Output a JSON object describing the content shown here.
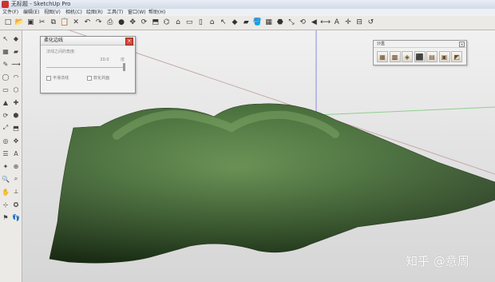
{
  "window": {
    "title": "无标题 - SketchUp Pro"
  },
  "menu": [
    "文件(F)",
    "编辑(E)",
    "视图(V)",
    "相机(C)",
    "绘图(R)",
    "工具(T)",
    "窗口(W)",
    "帮助(H)"
  ],
  "toolbar": {
    "icons": [
      "new-file-icon",
      "open-folder-icon",
      "save-icon",
      "cut-icon",
      "copy-icon",
      "paste-icon",
      "erase-icon",
      "undo-icon",
      "redo-icon",
      "print-icon",
      "model-info-icon",
      "move-icon",
      "rotate-icon",
      "push-pull-icon",
      "offset-icon",
      "iso-view-icon",
      "top-view-icon",
      "front-view-icon",
      "house-icon",
      "select-arrow-icon",
      "material-icon",
      "erase-tool-icon",
      "paint-bucket-icon",
      "components-icon",
      "follow-me-icon",
      "scale-icon",
      "rotate-tool-icon",
      "tape-icon",
      "dimension-icon",
      "text-icon",
      "axes-icon",
      "section-icon",
      "undo-view-icon"
    ],
    "glyphs": [
      "□",
      "📂",
      "▣",
      "✂",
      "⧉",
      "📋",
      "✕",
      "↶",
      "↷",
      "⎙",
      "●",
      "✥",
      "⟳",
      "⬒",
      "⌬",
      "⌂",
      "▭",
      "▯",
      "⌂",
      "↖",
      "◆",
      "▰",
      "🪣",
      "▦",
      "⬣",
      "⤡",
      "⟲",
      "◀",
      "⟷",
      "A",
      "✛",
      "⊟",
      "↺"
    ]
  },
  "lefttools": {
    "glyphs": [
      "↖",
      "◆",
      "▦",
      "▰",
      "✎",
      "⟿",
      "◯",
      "◠",
      "▭",
      "⬡",
      "▲",
      "✚",
      "⟳",
      "⬢",
      "⤢",
      "⬒",
      "◎",
      "✥",
      "☰",
      "A",
      "✦",
      "⊕",
      "🔍",
      "⌕",
      "✋",
      "⟂",
      "⊹",
      "✪",
      "⚑",
      "👣"
    ]
  },
  "soften_dialog": {
    "title": "柔化边线",
    "close": "×",
    "angle_label": "法线之间的角度:",
    "angle_value": "20.0",
    "unit": "度",
    "option_smooth": "平滑法线",
    "option_coplanar": "软化共面"
  },
  "sandbox": {
    "title": "沙盒",
    "close": "×",
    "tools": [
      "sandbox-from-contours-icon",
      "sandbox-from-scratch-icon",
      "smoove-icon",
      "stamp-icon",
      "drape-icon",
      "add-detail-icon",
      "flip-edge-icon"
    ],
    "glyphs": [
      "▦",
      "▩",
      "◈",
      "⬛",
      "▤",
      "▣",
      "◩"
    ]
  },
  "watermark": "知乎 @意周",
  "colors": {
    "terrain": "#3f6b2f",
    "axis_red": "#c9a9a9",
    "axis_green": "#8fcf8f",
    "axis_blue": "#8a8ad8"
  }
}
